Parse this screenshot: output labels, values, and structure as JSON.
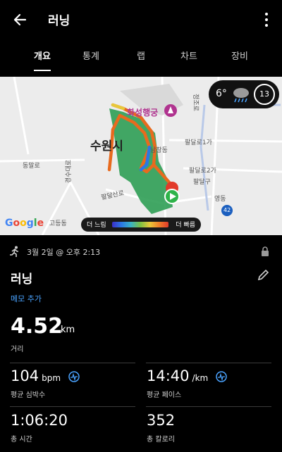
{
  "header": {
    "title": "러닝"
  },
  "tabs": [
    {
      "label": "개요",
      "active": true
    },
    {
      "label": "통계",
      "active": false
    },
    {
      "label": "랩",
      "active": false
    },
    {
      "label": "차트",
      "active": false
    },
    {
      "label": "장비",
      "active": false
    }
  ],
  "map": {
    "city_label": "수원시",
    "poi_label": "화성행궁",
    "road_labels": [
      "팔달로1가",
      "팔달로2가",
      "팔달구",
      "동말로",
      "팔달산로",
      "남창동",
      "영동",
      "고등동",
      "정조로",
      "경수대로",
      "42"
    ],
    "weather": {
      "temp": "6°",
      "aqi": "13"
    },
    "speed_legend": {
      "slow": "더 느림",
      "fast": "더 빠름"
    },
    "provider": "Google"
  },
  "activity": {
    "date": "3월 2일 @ 오후 2:13",
    "title": "러닝",
    "memo_link": "메모 추가",
    "distance": {
      "value": "4.52",
      "unit": "km",
      "label": "거리"
    },
    "stats": {
      "heart_rate": {
        "value": "104",
        "unit": "bpm",
        "label": "평균 심박수"
      },
      "pace": {
        "value": "14:40",
        "unit": "/km",
        "label": "평균 페이스"
      },
      "time": {
        "value": "1:06:20",
        "label": "총 시간"
      },
      "calories": {
        "value": "352",
        "label": "총 칼로리"
      }
    }
  },
  "colors": {
    "accent": "#4aa3ff",
    "background": "#000000",
    "park": "#2f9e55"
  }
}
